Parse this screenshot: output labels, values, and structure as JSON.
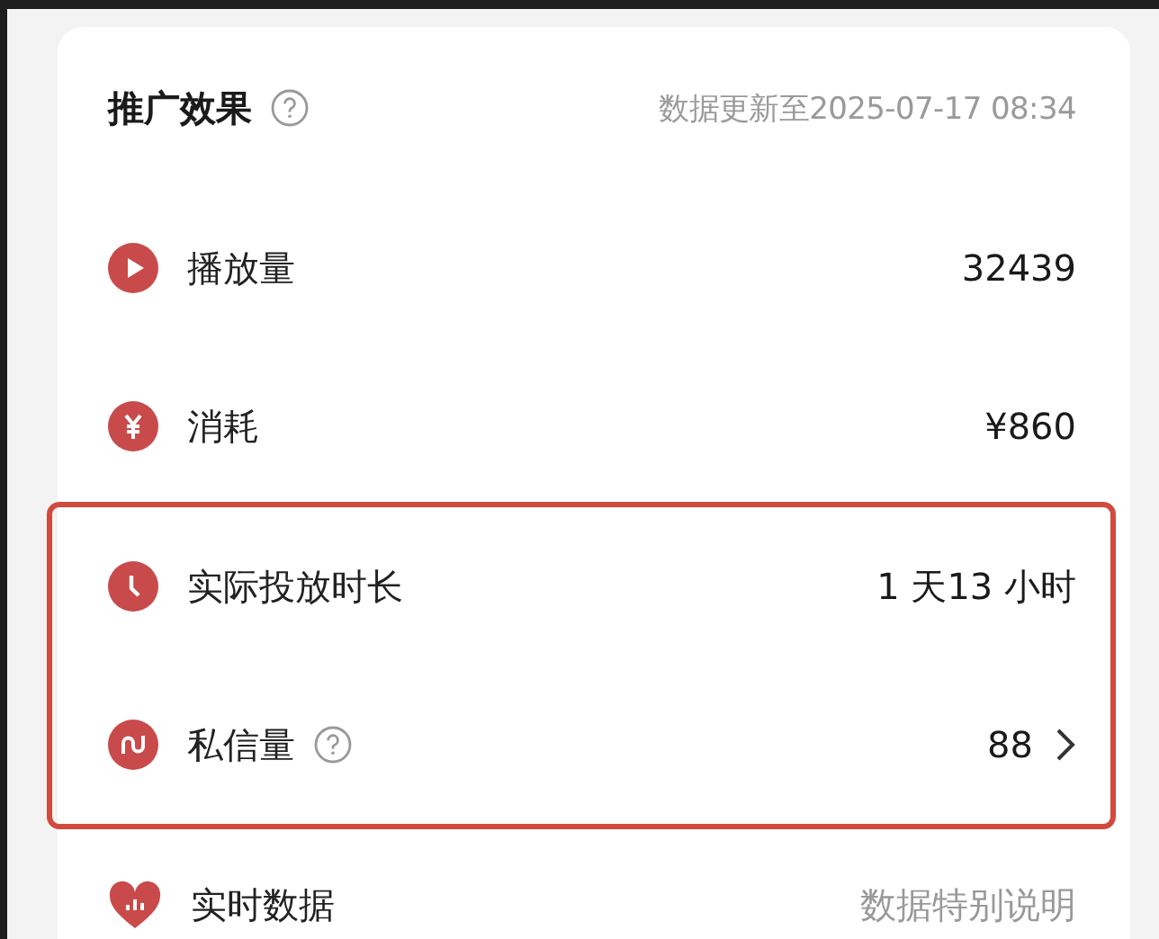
{
  "header": {
    "title": "推广效果",
    "help": true,
    "updated": "数据更新至2025-07-17 08:34"
  },
  "metrics": [
    {
      "kind": "play",
      "label": "播放量",
      "help": false,
      "value": "32439",
      "link": false,
      "highlighted": false
    },
    {
      "kind": "yen",
      "label": "消耗",
      "help": false,
      "value": "¥860",
      "link": false,
      "highlighted": false
    },
    {
      "kind": "clock",
      "label": "实际投放时长",
      "help": false,
      "value": "1 天13 小时",
      "link": false,
      "highlighted": true
    },
    {
      "kind": "wave",
      "label": "私信量",
      "help": true,
      "value": "88",
      "link": true,
      "highlighted": true
    },
    {
      "kind": "heart",
      "label": "实时数据",
      "help": false,
      "value": "数据特别说明",
      "link": false,
      "highlighted": false
    }
  ]
}
